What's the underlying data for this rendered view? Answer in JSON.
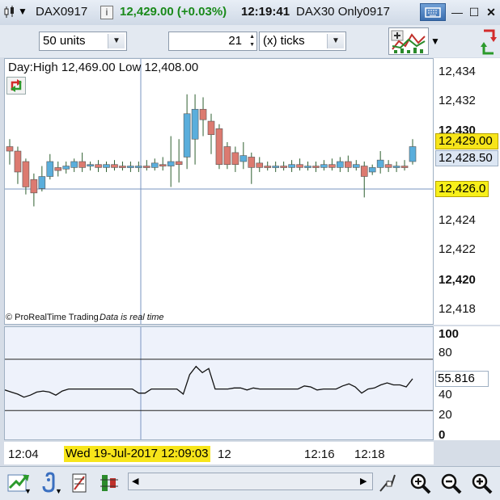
{
  "window": {
    "instrument": "DAX0917",
    "price_change": "12,429.00 (+0.03%)",
    "time": "12:19:41",
    "description": "DAX30 Only0917"
  },
  "toolbar": {
    "units_value": "50 units",
    "ticks_value": "21",
    "ticks_unit": "(x) ticks"
  },
  "chart": {
    "day_info": "Day:High 12,469.00 Low 12,408.00",
    "copyright": "© ProRealTime Trading",
    "realtime_note": "Data is real time",
    "price_axis": [
      "12,434",
      "12,432",
      "12,430",
      "12,424",
      "12,422",
      "12,420",
      "12,418"
    ],
    "last_price_label": "12,429.00",
    "bid_label": "12,428.50",
    "cursor_price_label": "12,426.0",
    "osc_axis": [
      "100",
      "80",
      "40",
      "20",
      "0"
    ],
    "osc_value_label": "55.816",
    "time_axis": [
      "12:04",
      "12",
      "12:16",
      "12:18"
    ],
    "cursor_time_label": "Wed 19-Jul-2017 12:09:03"
  },
  "chart_data": {
    "type": "candlestick",
    "price_ylim": [
      12417,
      12435
    ],
    "candles": [
      {
        "o": 12429.0,
        "h": 12429.5,
        "c": 12428.7,
        "l": 12427.8
      },
      {
        "o": 12428.7,
        "h": 12429.0,
        "c": 12427.3,
        "l": 12426.5
      },
      {
        "o": 12428.0,
        "h": 12428.2,
        "c": 12426.3,
        "l": 12425.8
      },
      {
        "o": 12426.8,
        "h": 12427.2,
        "c": 12425.9,
        "l": 12425.0
      },
      {
        "o": 12426.2,
        "h": 12427.7,
        "c": 12427.0,
        "l": 12426.0
      },
      {
        "o": 12427.0,
        "h": 12428.5,
        "c": 12428.0,
        "l": 12426.8
      },
      {
        "o": 12427.6,
        "h": 12428.0,
        "c": 12427.4,
        "l": 12427.0
      },
      {
        "o": 12427.5,
        "h": 12428.0,
        "c": 12427.7,
        "l": 12427.2
      },
      {
        "o": 12427.6,
        "h": 12428.2,
        "c": 12428.0,
        "l": 12427.3
      },
      {
        "o": 12428.0,
        "h": 12428.6,
        "c": 12427.6,
        "l": 12427.3
      },
      {
        "o": 12427.7,
        "h": 12428.0,
        "c": 12427.8,
        "l": 12427.4
      },
      {
        "o": 12427.8,
        "h": 12428.1,
        "c": 12427.6,
        "l": 12427.3
      },
      {
        "o": 12427.6,
        "h": 12428.0,
        "c": 12427.8,
        "l": 12427.3
      },
      {
        "o": 12427.8,
        "h": 12428.1,
        "c": 12427.6,
        "l": 12427.4
      },
      {
        "o": 12427.7,
        "h": 12428.0,
        "c": 12427.6,
        "l": 12427.4
      },
      {
        "o": 12427.6,
        "h": 12428.0,
        "c": 12427.7,
        "l": 12427.3
      },
      {
        "o": 12427.7,
        "h": 12428.0,
        "c": 12427.7,
        "l": 12427.3
      },
      {
        "o": 12427.7,
        "h": 12428.1,
        "c": 12427.6,
        "l": 12427.4
      },
      {
        "o": 12427.6,
        "h": 12428.2,
        "c": 12427.9,
        "l": 12427.4
      },
      {
        "o": 12427.8,
        "h": 12428.3,
        "c": 12427.7,
        "l": 12427.4
      },
      {
        "o": 12427.7,
        "h": 12429.7,
        "c": 12428.0,
        "l": 12426.3
      },
      {
        "o": 12428.0,
        "h": 12429.5,
        "c": 12427.8,
        "l": 12426.6
      },
      {
        "o": 12428.3,
        "h": 12432.5,
        "c": 12431.2,
        "l": 12427.5
      },
      {
        "o": 12429.5,
        "h": 12432.5,
        "c": 12431.5,
        "l": 12427.8
      },
      {
        "o": 12431.5,
        "h": 12432.3,
        "c": 12430.8,
        "l": 12429.7
      },
      {
        "o": 12430.7,
        "h": 12431.2,
        "c": 12429.8,
        "l": 12428.5
      },
      {
        "o": 12430.2,
        "h": 12430.5,
        "c": 12427.8,
        "l": 12427.5
      },
      {
        "o": 12429.0,
        "h": 12429.3,
        "c": 12427.8,
        "l": 12427.5
      },
      {
        "o": 12428.6,
        "h": 12429.0,
        "c": 12427.8,
        "l": 12427.3
      },
      {
        "o": 12428.0,
        "h": 12429.3,
        "c": 12428.4,
        "l": 12427.5
      },
      {
        "o": 12428.3,
        "h": 12428.6,
        "c": 12427.6,
        "l": 12426.5
      },
      {
        "o": 12427.9,
        "h": 12428.3,
        "c": 12427.6,
        "l": 12427.3
      },
      {
        "o": 12427.7,
        "h": 12428.0,
        "c": 12427.6,
        "l": 12427.4
      },
      {
        "o": 12427.6,
        "h": 12428.0,
        "c": 12427.7,
        "l": 12427.3
      },
      {
        "o": 12427.7,
        "h": 12428.0,
        "c": 12427.6,
        "l": 12427.4
      },
      {
        "o": 12427.6,
        "h": 12428.1,
        "c": 12427.8,
        "l": 12427.3
      },
      {
        "o": 12427.8,
        "h": 12428.2,
        "c": 12427.6,
        "l": 12427.4
      },
      {
        "o": 12427.7,
        "h": 12428.0,
        "c": 12427.7,
        "l": 12427.4
      },
      {
        "o": 12427.7,
        "h": 12428.0,
        "c": 12427.6,
        "l": 12427.3
      },
      {
        "o": 12427.6,
        "h": 12428.1,
        "c": 12427.8,
        "l": 12427.4
      },
      {
        "o": 12427.8,
        "h": 12428.2,
        "c": 12427.6,
        "l": 12427.4
      },
      {
        "o": 12427.6,
        "h": 12428.3,
        "c": 12428.0,
        "l": 12427.3
      },
      {
        "o": 12428.0,
        "h": 12428.4,
        "c": 12427.6,
        "l": 12427.3
      },
      {
        "o": 12427.6,
        "h": 12428.1,
        "c": 12427.8,
        "l": 12427.4
      },
      {
        "o": 12427.7,
        "h": 12428.0,
        "c": 12427.0,
        "l": 12425.6
      },
      {
        "o": 12427.3,
        "h": 12427.8,
        "c": 12427.6,
        "l": 12427.1
      },
      {
        "o": 12427.6,
        "h": 12428.7,
        "c": 12428.1,
        "l": 12427.2
      },
      {
        "o": 12427.8,
        "h": 12428.1,
        "c": 12427.6,
        "l": 12427.3
      },
      {
        "o": 12427.6,
        "h": 12428.0,
        "c": 12427.7,
        "l": 12427.3
      },
      {
        "o": 12427.7,
        "h": 12428.1,
        "c": 12427.6,
        "l": 12427.4
      },
      {
        "o": 12428.0,
        "h": 12429.5,
        "c": 12429.0,
        "l": 12427.8
      }
    ],
    "oscillator": {
      "ylim": [
        0,
        100
      ],
      "upper_level": 75,
      "lower_level": 25,
      "values": [
        45,
        43,
        41,
        38,
        40,
        43,
        44,
        43,
        40,
        44,
        46,
        46,
        46,
        46,
        46,
        46,
        46,
        46,
        46,
        46,
        46,
        42,
        42,
        46,
        46,
        46,
        46,
        46,
        41,
        60,
        68,
        62,
        66,
        46,
        46,
        46,
        47,
        47,
        45,
        47,
        46,
        46,
        46,
        46,
        46,
        46,
        46,
        49,
        48,
        45,
        46,
        46,
        46,
        49,
        51,
        48,
        42,
        46,
        47,
        50,
        52,
        50,
        50,
        48,
        56
      ]
    },
    "colors": {
      "up": "#5aaedc",
      "down": "#dc7a70",
      "wick": "#2e5f30",
      "osc_line": "#111111",
      "crosshair": "#7a94c0"
    }
  }
}
